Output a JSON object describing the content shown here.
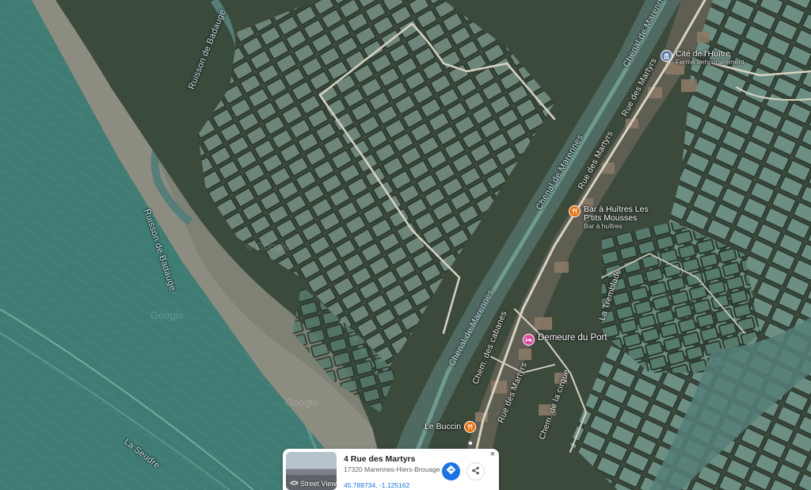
{
  "map": {
    "water_labels": [
      {
        "key": "badauge_upper",
        "text": "Ruisson de Badauge"
      },
      {
        "key": "badauge_lower",
        "text": "Ruisson de Badauge"
      },
      {
        "key": "seudre",
        "text": "La Seudre"
      },
      {
        "key": "chenal_1",
        "text": "Chenal de Marennes"
      },
      {
        "key": "chenal_2",
        "text": "Chenal de Marennes"
      },
      {
        "key": "chenal_3",
        "text": "Chenal de Marennes"
      }
    ],
    "road_labels": [
      {
        "key": "martyrs_1",
        "text": "Rue des Martyrs"
      },
      {
        "key": "martyrs_2",
        "text": "Rue des Martyrs"
      },
      {
        "key": "martyrs_3",
        "text": "Rue des Martyrs"
      },
      {
        "key": "cabanes",
        "text": "Chem. des cabanes"
      },
      {
        "key": "cirque",
        "text": "Chem. de la cirque"
      },
      {
        "key": "tremblade",
        "text": "La Tremblade"
      }
    ],
    "pois": [
      {
        "key": "cite",
        "name": "Cité de l'Huître",
        "subtitle": "Fermé temporairement",
        "icon": "museum-icon"
      },
      {
        "key": "bar",
        "name": "Bar à Huîtres Les P'tits Mousses",
        "name_line1": "Bar à Huîtres Les",
        "name_line2": "P'tits Mousses",
        "subtitle": "Bar à huîtres",
        "icon": "restaurant-icon"
      },
      {
        "key": "demeure",
        "name": "Demeure du Port",
        "subtitle": "",
        "icon": "hotel-icon"
      },
      {
        "key": "buccin",
        "name": "Le Buccin",
        "subtitle": "",
        "icon": "restaurant-icon"
      }
    ],
    "watermarks": [
      "© Google",
      "Google",
      "Google"
    ]
  },
  "card": {
    "title": "4 Rue des Martyrs",
    "address": "17320 Marennes-Hiers-Brouage",
    "coordinates": "45.789734, -1.125162",
    "street_view_label": "Street View",
    "close_label": "×"
  },
  "colors": {
    "sea": "#3f7d74",
    "mudflat": "#8a8a7c",
    "marsh": "#3b4a3a",
    "pond": "#5f7f73",
    "road": "#d9d6c8",
    "accent": "#1a73e8"
  }
}
